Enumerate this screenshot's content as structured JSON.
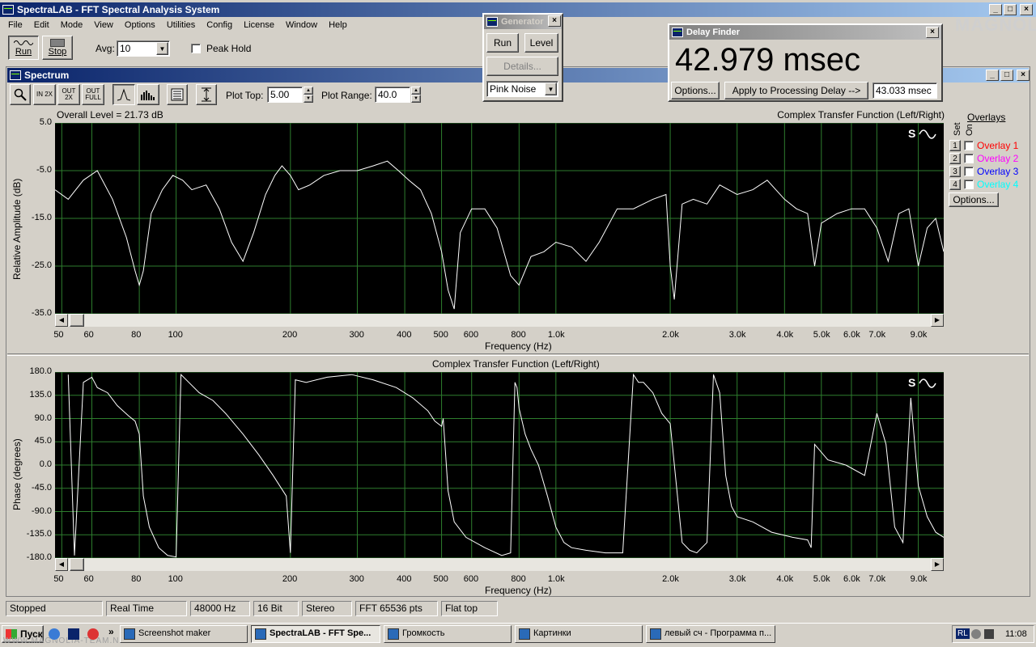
{
  "app": {
    "title": "SpectraLAB - FFT Spectral Analysis System",
    "menu": [
      "File",
      "Edit",
      "Mode",
      "View",
      "Options",
      "Utilities",
      "Config",
      "License",
      "Window",
      "Help"
    ]
  },
  "toolbar": {
    "run_label": "Run",
    "stop_label": "Stop",
    "avg_label": "Avg:",
    "avg_value": "10",
    "peak_hold_label": "Peak Hold"
  },
  "generator": {
    "title": "Generator",
    "run_label": "Run",
    "level_label": "Level",
    "details_label": "Details...",
    "signal_value": "Pink Noise"
  },
  "delay_finder": {
    "title": "Delay Finder",
    "value": "42.979 msec",
    "options_label": "Options...",
    "apply_label": "Apply to Processing Delay -->",
    "processing_delay": "43.033 msec"
  },
  "watermark": "MAGNOLIA",
  "spectrum_window": {
    "title": "Spectrum",
    "plot_top_label": "Plot Top:",
    "plot_top_value": "5.00",
    "plot_range_label": "Plot Range:",
    "plot_range_value": "40.0",
    "zoom_labels": [
      "IN 2X",
      "OUT 2X",
      "OUT FULL"
    ]
  },
  "overlays": {
    "title": "Overlays",
    "set_label": "Set",
    "on_label": "On",
    "items": [
      {
        "num": "1",
        "label": "Overlay 1",
        "color": "#ff0000"
      },
      {
        "num": "2",
        "label": "Overlay 2",
        "color": "#ff00ff"
      },
      {
        "num": "3",
        "label": "Overlay 3",
        "color": "#0000ff"
      },
      {
        "num": "4",
        "label": "Overlay 4",
        "color": "#00ffff"
      }
    ],
    "options_label": "Options..."
  },
  "x_ticks": [
    "50",
    "60",
    "80",
    "100",
    "200",
    "300",
    "400",
    "500",
    "600",
    "800",
    "1.0k",
    "2.0k",
    "3.0k",
    "4.0k",
    "5.0k",
    "6.0k",
    "7.0k",
    "9.0k"
  ],
  "chart_data": [
    {
      "type": "line",
      "title": "Complex Transfer Function (Left/Right)",
      "annotation": "Overall Level = 21.73 dB",
      "xlabel": "Frequency (Hz)",
      "ylabel": "Relative Amplitude (dB)",
      "x_scale": "log",
      "xlim": [
        48,
        10500
      ],
      "ylim": [
        -35,
        5
      ],
      "y_ticks": [
        "5.0",
        "-5.0",
        "-15.0",
        "-25.0",
        "-35.0"
      ],
      "grid": true,
      "series": [
        {
          "color": "#ffffff",
          "x": [
            48,
            52,
            57,
            62,
            68,
            74,
            78,
            80,
            82,
            86,
            92,
            98,
            104,
            110,
            120,
            130,
            140,
            150,
            160,
            172,
            182,
            190,
            200,
            210,
            225,
            245,
            270,
            300,
            330,
            360,
            385,
            410,
            440,
            470,
            500,
            520,
            540,
            560,
            600,
            650,
            700,
            760,
            800,
            860,
            930,
            1000,
            1100,
            1200,
            1300,
            1450,
            1600,
            1800,
            1950,
            2000,
            2050,
            2150,
            2300,
            2500,
            2700,
            3000,
            3300,
            3600,
            4000,
            4300,
            4600,
            4800,
            5000,
            5500,
            6000,
            6500,
            7000,
            7500,
            8000,
            8500,
            9000,
            9500,
            10000,
            10500
          ],
          "y": [
            -9,
            -11,
            -7,
            -5,
            -11,
            -19,
            -26,
            -29,
            -26,
            -14,
            -9,
            -6,
            -7,
            -9,
            -8,
            -13,
            -20,
            -24,
            -18,
            -10,
            -6,
            -4,
            -6,
            -9,
            -8,
            -6,
            -5,
            -5,
            -4,
            -3,
            -5,
            -7,
            -9,
            -14,
            -22,
            -30,
            -34,
            -18,
            -13,
            -13,
            -17,
            -27,
            -29,
            -23,
            -22,
            -20,
            -21,
            -24,
            -20,
            -13,
            -13,
            -11,
            -10,
            -25,
            -32,
            -12,
            -11,
            -12,
            -8,
            -10,
            -9,
            -7,
            -11,
            -13,
            -14,
            -25,
            -16,
            -14,
            -13,
            -13,
            -17,
            -24,
            -14,
            -13,
            -25,
            -17,
            -15,
            -22
          ]
        }
      ]
    },
    {
      "type": "line",
      "title": "Complex Transfer Function (Left/Right)",
      "xlabel": "Frequency (Hz)",
      "ylabel": "Phase (degrees)",
      "x_scale": "log",
      "xlim": [
        48,
        10500
      ],
      "ylim": [
        -180,
        180
      ],
      "y_ticks": [
        "180.0",
        "135.0",
        "90.0",
        "45.0",
        "0.0",
        "-45.0",
        "-90.0",
        "-135.0",
        "-180.0"
      ],
      "grid": true,
      "series": [
        {
          "color": "#ffffff",
          "x": [
            52,
            54,
            57,
            60,
            62,
            66,
            70,
            75,
            78,
            80,
            82,
            85,
            90,
            95,
            100,
            103,
            108,
            115,
            125,
            135,
            150,
            165,
            180,
            195,
            200,
            206,
            220,
            250,
            290,
            330,
            380,
            420,
            460,
            480,
            500,
            505,
            520,
            540,
            580,
            650,
            720,
            760,
            780,
            790,
            800,
            830,
            860,
            900,
            950,
            1000,
            1050,
            1100,
            1200,
            1350,
            1500,
            1600,
            1650,
            1700,
            1800,
            1900,
            2000,
            2150,
            2250,
            2350,
            2500,
            2600,
            2700,
            2800,
            2900,
            3000,
            3300,
            3700,
            4200,
            4600,
            4700,
            4800,
            5200,
            5800,
            6500,
            7000,
            7400,
            7800,
            8200,
            8600,
            9000,
            9500,
            10000,
            10500
          ],
          "y": [
            175,
            -175,
            160,
            170,
            150,
            140,
            115,
            95,
            85,
            60,
            -60,
            -120,
            -160,
            -175,
            -178,
            175,
            160,
            140,
            125,
            100,
            60,
            20,
            -20,
            -60,
            -170,
            165,
            160,
            170,
            175,
            165,
            150,
            130,
            105,
            85,
            75,
            90,
            -50,
            -110,
            -140,
            -160,
            -175,
            -170,
            160,
            150,
            110,
            60,
            30,
            0,
            -60,
            -120,
            -150,
            -160,
            -165,
            -170,
            -170,
            175,
            160,
            160,
            140,
            100,
            80,
            -150,
            -165,
            -170,
            -150,
            175,
            140,
            -20,
            -80,
            -100,
            -110,
            -130,
            -140,
            -145,
            -160,
            40,
            10,
            0,
            -20,
            100,
            40,
            -120,
            -150,
            130,
            -40,
            -100,
            -130,
            -140
          ]
        }
      ]
    }
  ],
  "status_bar": [
    "Stopped",
    "Real Time",
    "48000 Hz",
    "16 Bit",
    "Stereo",
    "FFT 65536 pts",
    "Flat top"
  ],
  "taskbar": {
    "start_label": "Пуск",
    "url_text": "WWW.MAGNOLIA-TEAM.NET",
    "tasks": [
      "Screenshot maker",
      "SpectraLAB - FFT Spe...",
      "Громкость",
      "Картинки",
      "левый сч - Программа п..."
    ],
    "lang": "RL",
    "clock": "11:08"
  }
}
